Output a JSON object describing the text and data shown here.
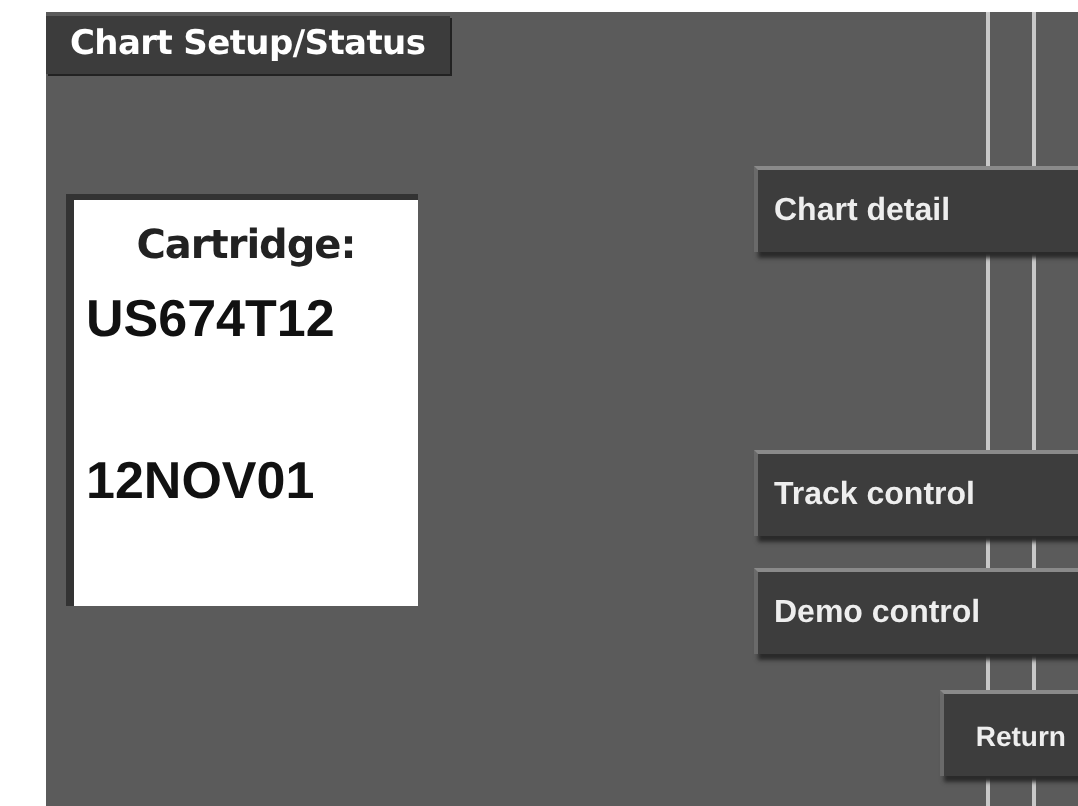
{
  "title": "Chart Setup/Status",
  "cartridge": {
    "label": "Cartridge:",
    "id": "US674T12",
    "date": "12NOV01"
  },
  "buttons": [
    {
      "label": "Chart detail",
      "kind": "wide"
    },
    {
      "label": "Track control",
      "kind": "wide"
    },
    {
      "label": "Demo control",
      "kind": "wide"
    },
    {
      "label": "Return",
      "kind": "small"
    }
  ]
}
